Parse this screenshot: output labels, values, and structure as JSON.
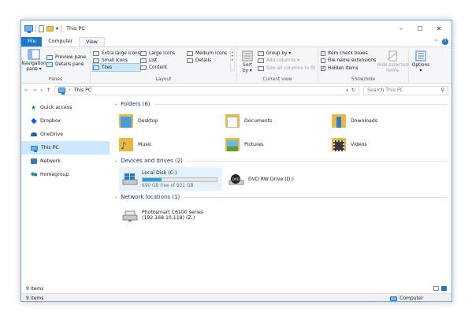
{
  "window": {
    "title": "This PC"
  },
  "tabs": [
    {
      "label": "File"
    },
    {
      "label": "Computer"
    },
    {
      "label": "View"
    }
  ],
  "ribbon": {
    "panes": {
      "label": "Panes",
      "navigation_pane": "Navigation\npane ▾",
      "preview_pane": "Preview pane",
      "details_pane": "Details pane"
    },
    "layout": {
      "label": "Layout",
      "options": [
        "Extra large icons",
        "Large icons",
        "Medium icons",
        "Small icons",
        "List",
        "Details",
        "Tiles",
        "Content"
      ],
      "selected": "Tiles"
    },
    "current_view": {
      "label": "Current view",
      "sort_by": "Sort\nby ▾",
      "group_by": "Group by ▾",
      "add_columns": "Add columns ▾",
      "size_columns": "Size all columns to fit"
    },
    "show_hide": {
      "label": "Show/hide",
      "item_check_boxes": "Item check boxes",
      "file_name_extensions": "File name extensions",
      "hidden_items": "Hidden items",
      "hide_selected": "Hide selected\nitems"
    },
    "options": "Options\n▾"
  },
  "address": {
    "path": "This PC",
    "search_placeholder": "Search This PC"
  },
  "nav": [
    {
      "label": "Quick access",
      "icon": "star-icon"
    },
    {
      "label": "Dropbox",
      "icon": "dropbox-icon"
    },
    {
      "label": "OneDrive",
      "icon": "cloud-icon"
    },
    {
      "label": "This PC",
      "icon": "computer-icon",
      "selected": true
    },
    {
      "label": "Network",
      "icon": "network-icon"
    },
    {
      "label": "Homegroup",
      "icon": "homegroup-icon"
    }
  ],
  "sections": {
    "folders": {
      "title": "Folders (6)",
      "items": [
        "Desktop",
        "Documents",
        "Downloads",
        "Music",
        "Pictures",
        "Videos"
      ]
    },
    "devices": {
      "title": "Devices and drives (2)",
      "local_disk": {
        "name": "Local Disk (C:)",
        "free": "690 GB free of 931 GB",
        "used_fraction": 0.26
      },
      "dvd": "DVD RW Drive (D:)"
    },
    "network": {
      "title": "Network locations (1)",
      "name": "Photosmart C6100 series",
      "sub": "(192.168.10.118) (Z:)"
    }
  },
  "status": {
    "count": "9 items",
    "bottom_count": "9 items",
    "computer": "Computer"
  },
  "colors": {
    "accent": "#1979ca",
    "selection": "#cce8ff"
  }
}
